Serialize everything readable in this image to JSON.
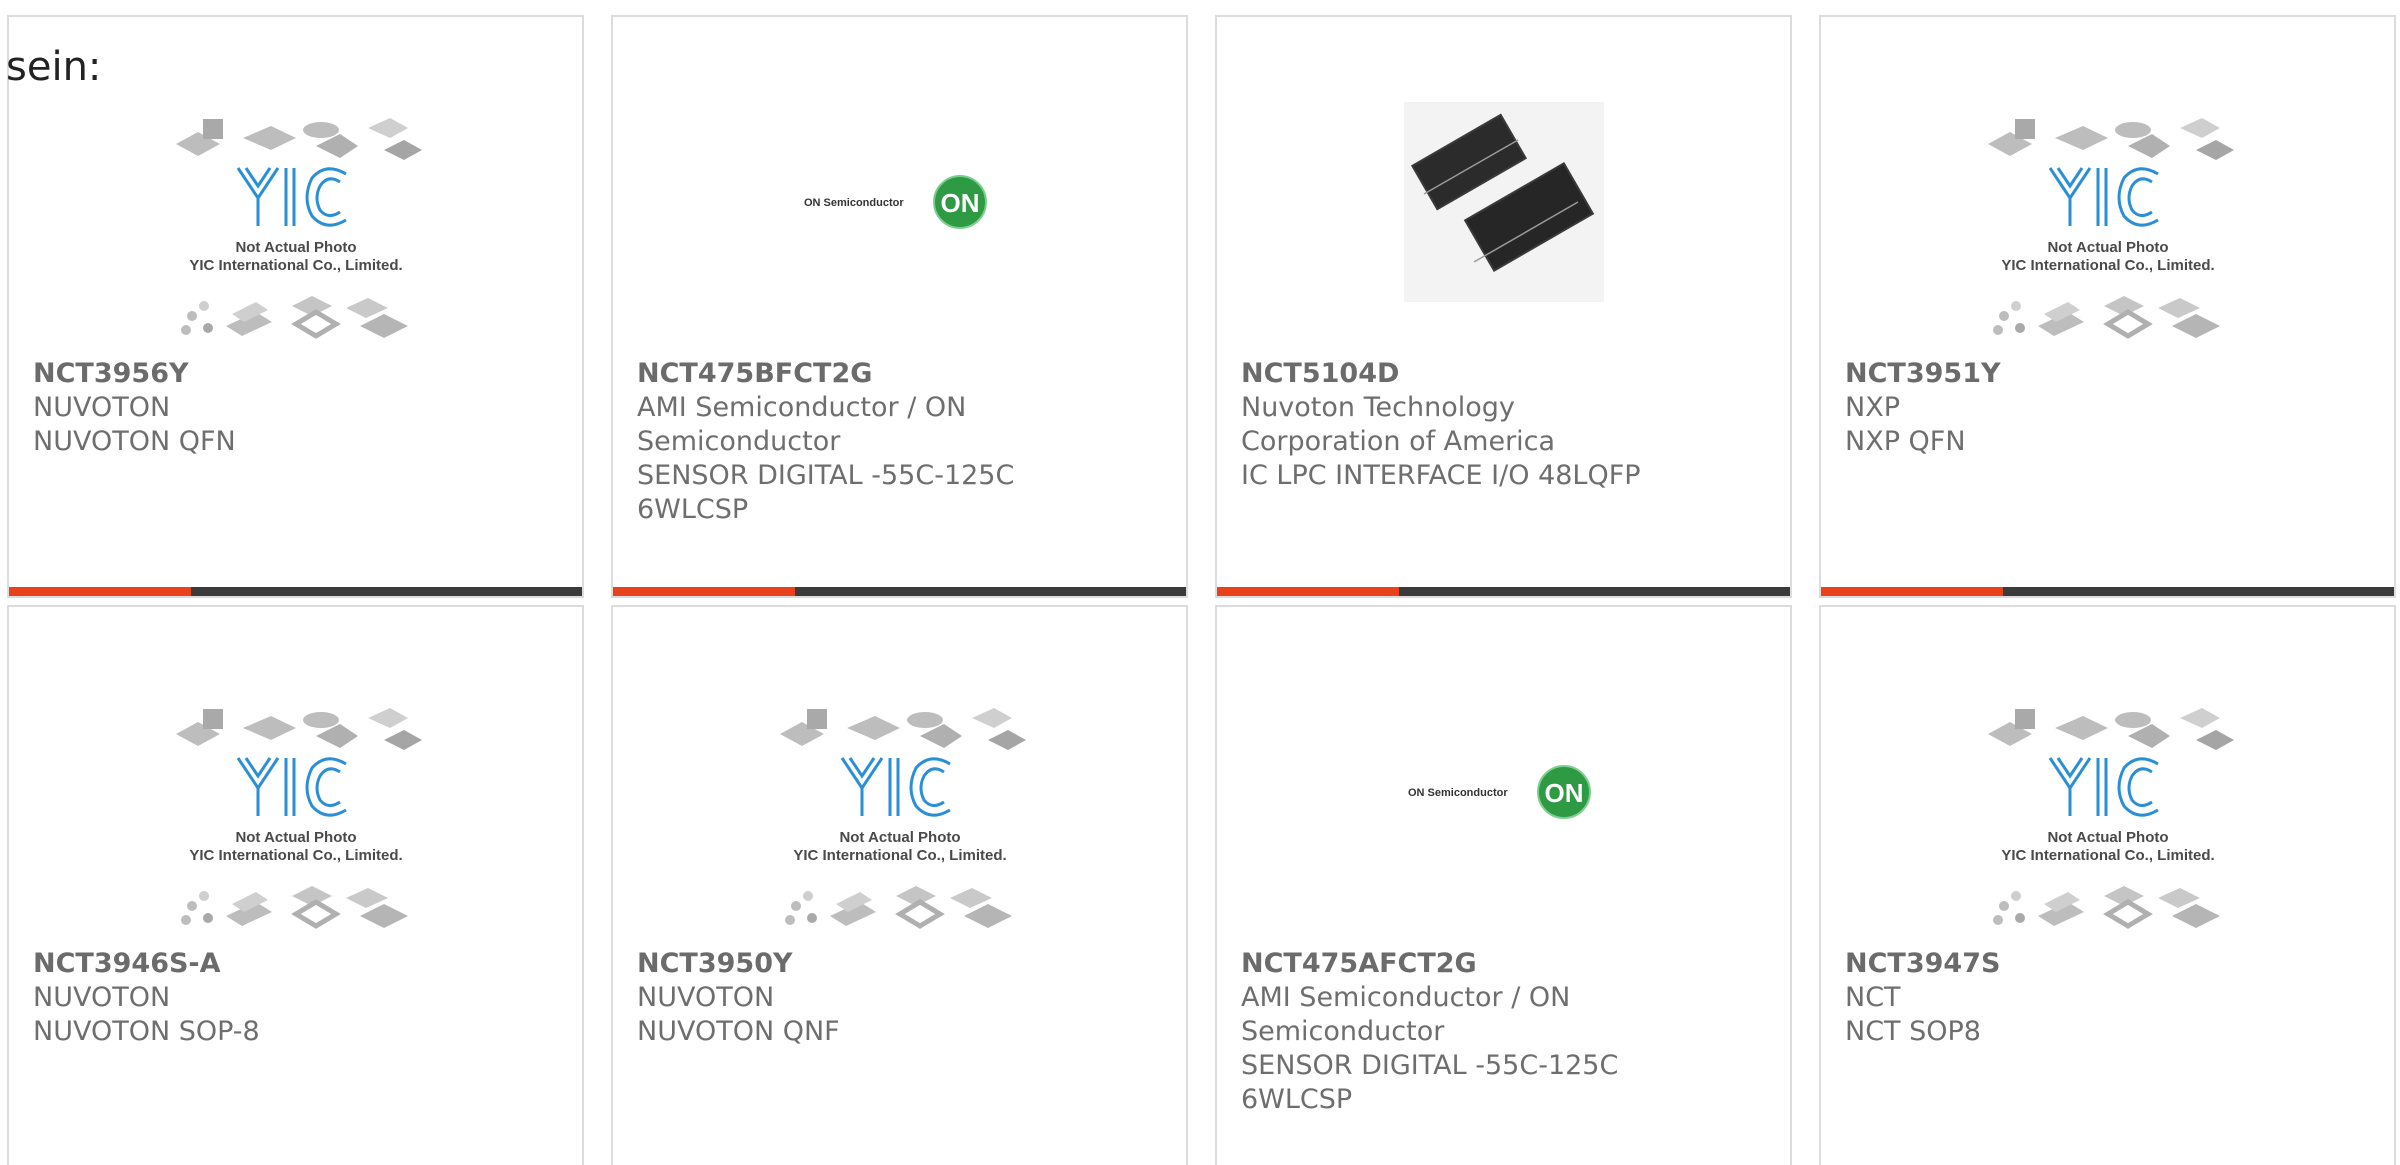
{
  "heading": "sein:",
  "placeholder": {
    "line1": "Not Actual Photo",
    "line2": "YIC International Co., Limited."
  },
  "on_logo": {
    "text": "ON Semiconductor",
    "mark": "ON"
  },
  "products": [
    {
      "part": "NCT3956Y",
      "manufacturer": "NUVOTON",
      "description": "NUVOTON QFN",
      "image": "yic-placeholder"
    },
    {
      "part": "NCT475BFCT2G",
      "manufacturer": "AMI Semiconductor / ON Semiconductor",
      "description": "SENSOR DIGITAL -55C-125C 6WLCSP",
      "image": "on-semiconductor-logo"
    },
    {
      "part": "NCT5104D",
      "manufacturer": "Nuvoton Technology Corporation of America",
      "description": "IC LPC INTERFACE I/O 48LQFP",
      "image": "lqfp-chip-photo"
    },
    {
      "part": "NCT3951Y",
      "manufacturer": "NXP",
      "description": "NXP QFN",
      "image": "yic-placeholder"
    },
    {
      "part": "NCT3946S-A",
      "manufacturer": "NUVOTON",
      "description": "NUVOTON SOP-8",
      "image": "yic-placeholder"
    },
    {
      "part": "NCT3950Y",
      "manufacturer": "NUVOTON",
      "description": "NUVOTON QNF",
      "image": "yic-placeholder"
    },
    {
      "part": "NCT475AFCT2G",
      "manufacturer": "AMI Semiconductor / ON Semiconductor",
      "description": "SENSOR DIGITAL -55C-125C 6WLCSP",
      "image": "on-semiconductor-logo"
    },
    {
      "part": "NCT3947S",
      "manufacturer": "NCT",
      "description": "NCT SOP8",
      "image": "yic-placeholder"
    }
  ],
  "colors": {
    "accent": "#e8411b",
    "bar": "#3b3b3b",
    "border": "#dcdcdc",
    "text": "#6e6e6e",
    "yic_blue": "#2b8fd6",
    "on_green": "#2e9a44"
  }
}
